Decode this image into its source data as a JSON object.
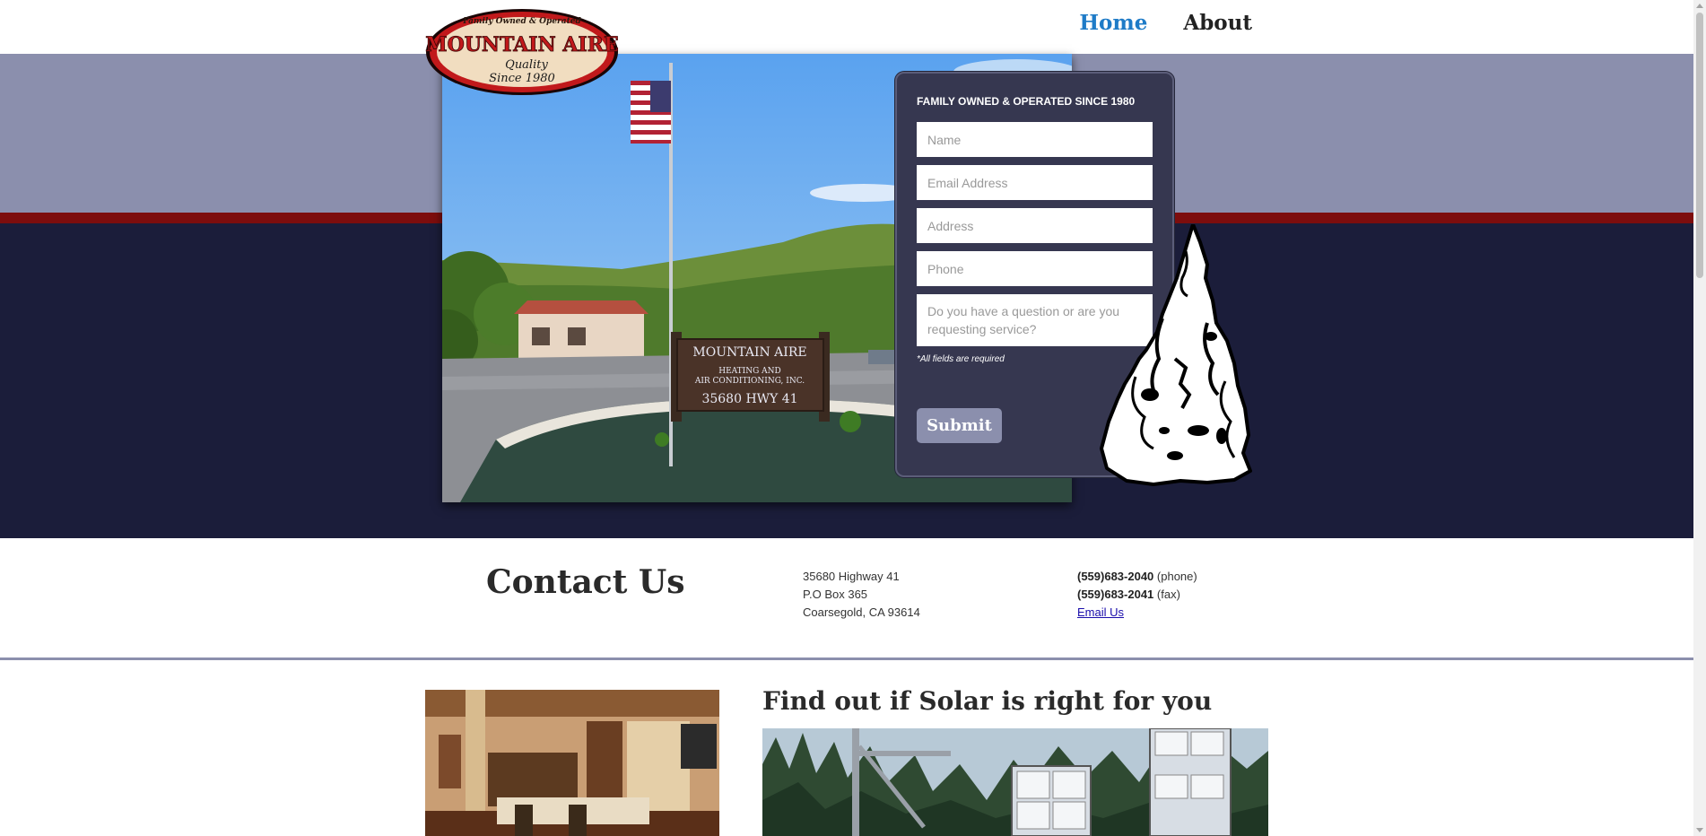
{
  "header": {
    "logo": {
      "top_text": "Family Owned & Operated",
      "brand": "MOUNTAIN AIRE",
      "tagline_1": "Quality",
      "tagline_2": "Since 1980"
    },
    "nav": [
      {
        "label": "Home",
        "active": true
      },
      {
        "label": "About",
        "active": false
      }
    ]
  },
  "hero": {
    "photo": {
      "sign_line_1": "MOUNTAIN AIRE",
      "sign_line_2": "HEATING AND",
      "sign_line_3": "AIR CONDITIONING, INC.",
      "sign_line_4": "35680 HWY 41"
    },
    "form": {
      "title": "FAMILY OWNED & OPERATED SINCE 1980",
      "name_placeholder": "Name",
      "email_placeholder": "Email Address",
      "address_placeholder": "Address",
      "phone_placeholder": "Phone",
      "message_placeholder": "Do you have a question or are you requesting service?",
      "note": "*All fields are required",
      "submit_label": "Submit"
    }
  },
  "contact": {
    "heading": "Contact Us",
    "address_lines": [
      "35680 Highway 41",
      "P.O Box 365",
      "Coarsegold, CA 93614"
    ],
    "phone_number": "(559)683-2040",
    "phone_suffix": " (phone)",
    "fax_number": "(559)683-2041",
    "fax_suffix": " (fax)",
    "email_label": "Email Us"
  },
  "solar": {
    "heading": "Find out if Solar is right for you"
  },
  "colors": {
    "accent_blue": "#1e7bc7",
    "band_light": "#8b8fad",
    "band_red": "#7d0d0d",
    "band_dark": "#1b1d3a",
    "panel": "#363750"
  }
}
